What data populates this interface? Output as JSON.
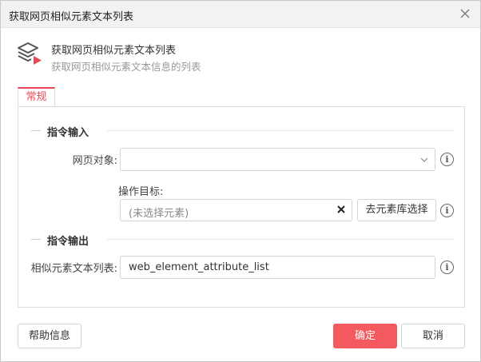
{
  "window": {
    "title": "获取网页相似元素文本列表"
  },
  "header": {
    "title": "获取网页相似元素文本列表",
    "subtitle": "获取网页相似元素文本信息的列表",
    "icon": "layers-arrow-icon"
  },
  "tabs": [
    {
      "label": "常规",
      "active": true
    }
  ],
  "sections": {
    "input": {
      "label": "指令输入"
    },
    "output": {
      "label": "指令输出"
    }
  },
  "fields": {
    "web_object": {
      "label": "网页对象:",
      "value": ""
    },
    "target": {
      "label": "操作目标:",
      "placeholder": "(未选择元素)",
      "library_button": "去元素库选择"
    },
    "result_list": {
      "label": "相似元素文本列表:",
      "value": "web_element_attribute_list"
    }
  },
  "info_glyph": "i",
  "footer": {
    "help_label": "帮助信息",
    "ok_label": "确定",
    "cancel_label": "取消"
  },
  "colors": {
    "accent": "#e64a57",
    "primary_button": "#f25a5f",
    "titlebar": "#f2f2f2"
  }
}
